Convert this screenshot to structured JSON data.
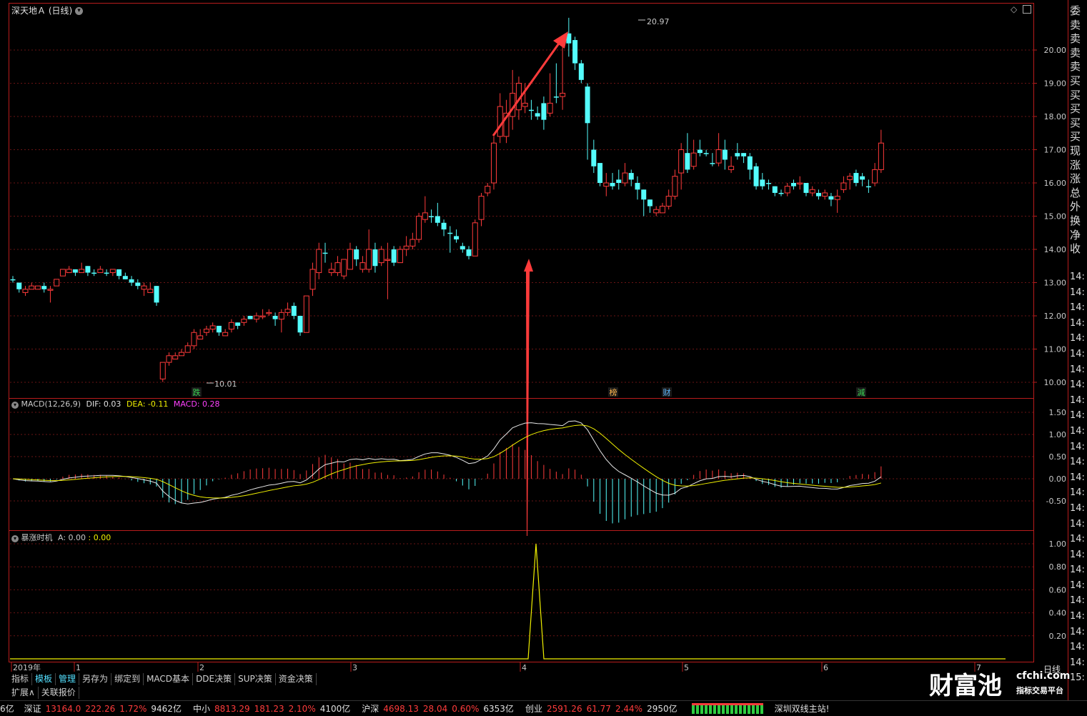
{
  "window": {
    "stock_title": "深天地Ａ (日线)",
    "period_label": "日线"
  },
  "main_chart": {
    "y_ticks": [
      "20.00",
      "19.00",
      "18.00",
      "17.00",
      "16.00",
      "15.00",
      "14.00",
      "13.00",
      "12.00",
      "11.00",
      "10.00"
    ],
    "high_label": "20.97",
    "low_label": "10.01",
    "markers": [
      "跌",
      "榜",
      "财",
      "減"
    ],
    "colors": {
      "up": "#ff3b3b",
      "down": "#54fcfc",
      "arrow": "#ff3b3b"
    }
  },
  "macd_panel": {
    "name": "MACD(12,26,9)",
    "dif": "DIF: 0.03",
    "dea": "DEA: -0.11",
    "macd": "MACD: 0.28",
    "y_ticks": [
      "1.50",
      "1.00",
      "0.50",
      "0.00",
      "-0.50"
    ]
  },
  "indicator_panel": {
    "name": "暴涨时机",
    "value_a": "A: 0.00",
    "value_b": ": 0.00",
    "y_ticks": [
      "1.00",
      "0.80",
      "0.60",
      "0.40",
      "0.20"
    ]
  },
  "x_axis": [
    "2019年",
    "1",
    "2",
    "3",
    "4",
    "5",
    "6",
    "7"
  ],
  "tabs": [
    "指标",
    "模板",
    "管理",
    "另存为",
    "绑定到",
    "MACD基本",
    "DDE决策",
    "SUP决策",
    "资金决策"
  ],
  "sub_tabs": [
    "扩展∧",
    "关联报价"
  ],
  "right_panel": {
    "labels": [
      "委",
      "卖",
      "卖",
      "卖",
      "卖",
      "买",
      "买",
      "买",
      "买",
      "买",
      "现",
      "涨",
      "涨",
      "总",
      "外",
      "换",
      "净",
      "收"
    ],
    "times": [
      "14:",
      "14:",
      "14:",
      "14:",
      "14:",
      "14:",
      "14:",
      "14:",
      "14:",
      "14:",
      "14:",
      "14:",
      "14:",
      "14:",
      "14:",
      "14:",
      "14:",
      "14:",
      "14:",
      "14:",
      "14:",
      "14:",
      "14:",
      "14:",
      "14:",
      "14:",
      "15:"
    ]
  },
  "status_bar": {
    "prefix": "6亿",
    "items": [
      {
        "name": "深证",
        "value": "13164.0",
        "change": "222.26",
        "pct": "1.72%",
        "vol": "9462亿"
      },
      {
        "name": "中小",
        "value": "8813.29",
        "change": "181.23",
        "pct": "2.10%",
        "vol": "4100亿"
      },
      {
        "name": "沪深",
        "value": "4698.13",
        "change": "28.04",
        "pct": "0.60%",
        "vol": "6353亿"
      },
      {
        "name": "创业",
        "value": "2591.26",
        "change": "61.77",
        "pct": "2.44%",
        "vol": "2950亿"
      }
    ],
    "server": "深圳双线主站!"
  },
  "watermark": {
    "brand": "财富池",
    "site": "cfchi.com",
    "slogan": "指标交易平台"
  },
  "chart_data": {
    "type": "candlestick",
    "y_range": [
      10.0,
      21.0
    ],
    "candles": [
      [
        13.1,
        13.1,
        13.2,
        13.0,
        "d"
      ],
      [
        13.0,
        12.8,
        13.0,
        12.7,
        "d"
      ],
      [
        12.7,
        12.8,
        12.9,
        12.6,
        "u"
      ],
      [
        12.8,
        12.9,
        13.0,
        12.8,
        "u"
      ],
      [
        12.8,
        12.9,
        12.9,
        12.8,
        "u"
      ],
      [
        12.9,
        12.8,
        13.0,
        12.7,
        "d"
      ],
      [
        12.8,
        12.8,
        12.9,
        12.4,
        "u"
      ],
      [
        12.9,
        13.1,
        13.1,
        12.9,
        "u"
      ],
      [
        13.2,
        13.4,
        13.4,
        13.2,
        "u"
      ],
      [
        13.3,
        13.4,
        13.5,
        13.3,
        "u"
      ],
      [
        13.4,
        13.3,
        13.4,
        13.2,
        "d"
      ],
      [
        13.3,
        13.4,
        13.6,
        13.3,
        "u"
      ],
      [
        13.5,
        13.3,
        13.5,
        13.2,
        "d"
      ],
      [
        13.3,
        13.3,
        13.4,
        13.2,
        "d"
      ],
      [
        13.3,
        13.4,
        13.5,
        13.3,
        "u"
      ],
      [
        13.3,
        13.3,
        13.4,
        13.2,
        "d"
      ],
      [
        13.4,
        13.3,
        13.4,
        13.2,
        "u"
      ],
      [
        13.4,
        13.2,
        13.4,
        13.1,
        "d"
      ],
      [
        13.2,
        13.1,
        13.3,
        13.1,
        "d"
      ],
      [
        13.1,
        13.0,
        13.2,
        12.9,
        "d"
      ],
      [
        13.0,
        12.9,
        13.1,
        12.8,
        "d"
      ],
      [
        12.9,
        12.8,
        13.0,
        12.6,
        "u"
      ],
      [
        12.8,
        12.7,
        13.0,
        12.7,
        "u"
      ],
      [
        12.9,
        12.4,
        12.9,
        12.3,
        "d"
      ],
      [
        10.1,
        10.6,
        10.6,
        10.01,
        "u"
      ],
      [
        10.6,
        10.8,
        10.9,
        10.5,
        "u"
      ],
      [
        10.7,
        10.8,
        10.9,
        10.7,
        "u"
      ],
      [
        10.8,
        10.9,
        11.0,
        10.8,
        "u"
      ],
      [
        10.9,
        11.1,
        11.2,
        10.9,
        "u"
      ],
      [
        11.1,
        11.5,
        11.6,
        11.0,
        "u"
      ],
      [
        11.3,
        11.4,
        11.6,
        11.3,
        "u"
      ],
      [
        11.5,
        11.6,
        11.7,
        11.4,
        "u"
      ],
      [
        11.6,
        11.7,
        11.8,
        11.5,
        "u"
      ],
      [
        11.7,
        11.5,
        11.7,
        11.4,
        "d"
      ],
      [
        11.4,
        11.5,
        11.6,
        11.4,
        "u"
      ],
      [
        11.6,
        11.8,
        11.9,
        11.5,
        "u"
      ],
      [
        11.8,
        11.7,
        11.8,
        11.6,
        "d"
      ],
      [
        11.8,
        11.9,
        12.0,
        11.7,
        "u"
      ],
      [
        11.9,
        12.0,
        12.0,
        11.9,
        "d"
      ],
      [
        11.9,
        12.0,
        12.1,
        11.8,
        "u"
      ],
      [
        12.0,
        12.0,
        12.2,
        11.9,
        "u"
      ],
      [
        12.1,
        12.1,
        12.2,
        12.0,
        "u"
      ],
      [
        12.0,
        11.9,
        12.1,
        11.7,
        "d"
      ],
      [
        11.9,
        12.1,
        12.2,
        11.5,
        "u"
      ],
      [
        12.1,
        12.2,
        12.4,
        12.0,
        "u"
      ],
      [
        12.3,
        12.0,
        12.4,
        11.9,
        "d"
      ],
      [
        12.0,
        11.5,
        12.0,
        11.4,
        "d"
      ],
      [
        11.5,
        12.6,
        12.6,
        11.5,
        "u"
      ],
      [
        12.8,
        13.4,
        13.6,
        12.6,
        "u"
      ],
      [
        13.3,
        14.0,
        14.2,
        13.1,
        "u"
      ],
      [
        13.9,
        13.9,
        14.2,
        13.6,
        "d"
      ],
      [
        13.3,
        13.4,
        13.6,
        13.2,
        "u"
      ],
      [
        13.3,
        13.6,
        13.8,
        13.2,
        "u"
      ],
      [
        13.7,
        13.2,
        13.7,
        13.1,
        "u"
      ],
      [
        13.4,
        14.0,
        14.2,
        13.4,
        "u"
      ],
      [
        14.0,
        13.7,
        14.1,
        13.5,
        "d"
      ],
      [
        13.6,
        13.4,
        13.8,
        13.3,
        "u"
      ],
      [
        13.4,
        14.0,
        14.6,
        13.3,
        "u"
      ],
      [
        14.0,
        13.5,
        14.2,
        13.3,
        "d"
      ],
      [
        13.6,
        14.0,
        14.1,
        13.5,
        "u"
      ],
      [
        13.7,
        13.7,
        14.2,
        12.5,
        "u"
      ],
      [
        13.6,
        14.0,
        14.1,
        13.5,
        "d"
      ],
      [
        14.0,
        13.6,
        14.1,
        13.6,
        "u"
      ],
      [
        14.0,
        14.1,
        14.4,
        13.8,
        "u"
      ],
      [
        14.1,
        14.3,
        14.5,
        14.0,
        "u"
      ],
      [
        14.3,
        15.0,
        15.1,
        14.2,
        "u"
      ],
      [
        14.9,
        15.1,
        15.6,
        14.8,
        "u"
      ],
      [
        15.0,
        15.0,
        15.2,
        14.8,
        "d"
      ],
      [
        15.0,
        14.8,
        15.4,
        14.7,
        "d"
      ],
      [
        14.8,
        14.6,
        14.9,
        14.4,
        "d"
      ],
      [
        14.5,
        14.5,
        14.7,
        13.9,
        "d"
      ],
      [
        14.4,
        14.3,
        14.6,
        14.2,
        "d"
      ],
      [
        14.1,
        14.0,
        14.2,
        13.9,
        "d"
      ],
      [
        14.0,
        13.8,
        14.1,
        13.7,
        "d"
      ],
      [
        13.8,
        14.8,
        14.9,
        13.8,
        "u"
      ],
      [
        14.9,
        15.6,
        15.7,
        14.7,
        "u"
      ],
      [
        15.7,
        15.9,
        16.0,
        15.6,
        "u"
      ],
      [
        16.0,
        17.2,
        17.4,
        15.8,
        "u"
      ],
      [
        17.4,
        18.3,
        18.7,
        17.2,
        "u"
      ],
      [
        17.4,
        18.1,
        18.5,
        17.2,
        "u"
      ],
      [
        18.0,
        18.7,
        19.4,
        17.6,
        "u"
      ],
      [
        19.0,
        18.2,
        19.2,
        17.9,
        "u"
      ],
      [
        18.3,
        18.4,
        19.0,
        18.1,
        "u"
      ],
      [
        18.2,
        18.2,
        18.5,
        17.9,
        "d"
      ],
      [
        18.0,
        18.1,
        18.3,
        17.9,
        "d"
      ],
      [
        17.9,
        18.4,
        18.6,
        17.6,
        "d"
      ],
      [
        18.1,
        18.4,
        19.3,
        18.0,
        "u"
      ],
      [
        18.6,
        18.6,
        19.6,
        18.4,
        "d"
      ],
      [
        18.6,
        18.7,
        20.4,
        18.2,
        "u"
      ],
      [
        20.5,
        20.2,
        20.97,
        19.8,
        "d"
      ],
      [
        20.3,
        19.6,
        20.4,
        19.4,
        "d"
      ],
      [
        19.6,
        19.1,
        19.7,
        19.0,
        "d"
      ],
      [
        18.9,
        17.8,
        19.0,
        16.7,
        "d"
      ],
      [
        17.0,
        16.5,
        17.3,
        16.3,
        "d"
      ],
      [
        16.6,
        16.0,
        16.6,
        15.9,
        "d"
      ],
      [
        16.0,
        15.9,
        16.3,
        15.6,
        "u"
      ],
      [
        15.9,
        16.0,
        16.3,
        15.8,
        "d"
      ],
      [
        16.0,
        16.1,
        16.4,
        15.8,
        "d"
      ],
      [
        16.0,
        16.3,
        16.6,
        15.9,
        "u"
      ],
      [
        16.3,
        16.1,
        16.4,
        15.9,
        "d"
      ],
      [
        16.0,
        15.8,
        16.2,
        15.5,
        "d"
      ],
      [
        15.8,
        15.5,
        15.8,
        15.0,
        "d"
      ],
      [
        15.5,
        15.3,
        15.5,
        15.1,
        "d"
      ],
      [
        15.2,
        15.1,
        15.3,
        15.0,
        "u"
      ],
      [
        15.1,
        15.3,
        15.4,
        15.1,
        "u"
      ],
      [
        15.3,
        15.6,
        15.8,
        15.2,
        "u"
      ],
      [
        15.6,
        16.2,
        16.4,
        15.5,
        "u"
      ],
      [
        16.3,
        17.0,
        17.2,
        15.8,
        "u"
      ],
      [
        16.9,
        16.4,
        17.5,
        16.3,
        "d"
      ],
      [
        16.5,
        16.9,
        17.3,
        16.4,
        "u"
      ],
      [
        16.9,
        17.0,
        17.3,
        16.8,
        "d"
      ],
      [
        16.9,
        16.9,
        17.0,
        16.8,
        "d"
      ],
      [
        16.6,
        16.6,
        16.9,
        16.5,
        "d"
      ],
      [
        16.6,
        17.0,
        17.5,
        16.5,
        "u"
      ],
      [
        17.0,
        16.7,
        17.3,
        16.4,
        "d"
      ],
      [
        16.4,
        16.5,
        16.8,
        16.3,
        "u"
      ],
      [
        16.8,
        16.9,
        17.2,
        16.7,
        "d"
      ],
      [
        16.9,
        16.8,
        16.9,
        16.6,
        "d"
      ],
      [
        16.8,
        16.4,
        16.9,
        16.1,
        "d"
      ],
      [
        16.5,
        15.9,
        16.6,
        15.8,
        "d"
      ],
      [
        16.1,
        15.9,
        16.3,
        15.8,
        "d"
      ],
      [
        16.0,
        16.0,
        16.1,
        15.8,
        "d"
      ],
      [
        15.9,
        15.7,
        15.9,
        15.6,
        "d"
      ],
      [
        15.7,
        15.7,
        15.8,
        15.6,
        "d"
      ],
      [
        15.7,
        15.9,
        16.0,
        15.6,
        "u"
      ],
      [
        15.9,
        16.0,
        16.1,
        15.8,
        "d"
      ],
      [
        16.0,
        16.0,
        16.2,
        15.8,
        "u"
      ],
      [
        16.0,
        15.7,
        16.0,
        15.6,
        "d"
      ],
      [
        15.8,
        15.7,
        15.9,
        15.6,
        "u"
      ],
      [
        15.7,
        15.6,
        15.8,
        15.5,
        "d"
      ],
      [
        15.6,
        15.7,
        15.8,
        15.5,
        "u"
      ],
      [
        15.6,
        15.5,
        15.7,
        15.3,
        "d"
      ],
      [
        15.5,
        15.6,
        15.8,
        15.1,
        "u"
      ],
      [
        15.8,
        16.0,
        16.2,
        15.7,
        "u"
      ],
      [
        16.1,
        16.2,
        16.3,
        15.8,
        "u"
      ],
      [
        16.3,
        16.0,
        16.4,
        15.9,
        "d"
      ],
      [
        16.2,
        16.1,
        16.3,
        15.9,
        "d"
      ],
      [
        15.9,
        15.9,
        16.1,
        15.7,
        "d"
      ],
      [
        16.0,
        16.4,
        16.6,
        15.9,
        "u"
      ],
      [
        16.4,
        17.2,
        17.6,
        16.3,
        "u"
      ]
    ]
  }
}
